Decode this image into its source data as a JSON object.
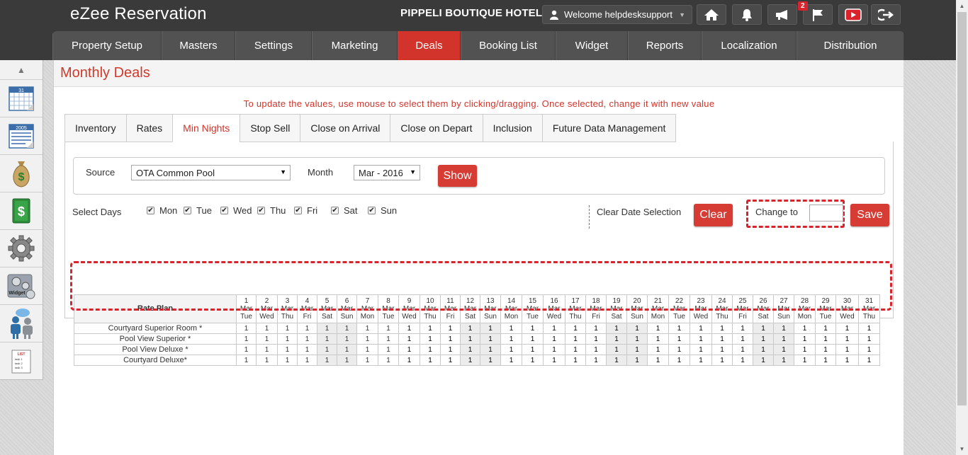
{
  "header": {
    "app_title": "eZee Reservation",
    "hotel_name": "PIPPELI BOUTIQUE HOTEL",
    "welcome": "Welcome helpdesksupport",
    "notification_count": "2",
    "icons": [
      "home-icon",
      "bell-icon",
      "megaphone-icon",
      "flag-icon",
      "youtube-icon",
      "logout-icon"
    ]
  },
  "nav": {
    "items": [
      {
        "label": "Property Setup",
        "active": false
      },
      {
        "label": "Masters",
        "active": false
      },
      {
        "label": "Settings",
        "active": false
      },
      {
        "label": "Marketing",
        "active": false
      },
      {
        "label": "Deals",
        "active": true
      },
      {
        "label": "Booking List",
        "active": false
      },
      {
        "label": "Widget",
        "active": false
      },
      {
        "label": "Reports",
        "active": false
      },
      {
        "label": "Localization",
        "active": false
      },
      {
        "label": "Distribution",
        "active": false
      }
    ]
  },
  "sidebar": {
    "calendar_small_label": "31",
    "calendar_year_label": "2005",
    "widget_label": "Widget",
    "list_label": "LIST",
    "list_tasks": [
      "task 1",
      "task 2",
      "task 3"
    ]
  },
  "page": {
    "title": "Monthly Deals",
    "instruction": "To update the values, use mouse to select them by clicking/dragging. Once selected, change it with new value"
  },
  "tabs": [
    {
      "label": "Inventory",
      "active": false
    },
    {
      "label": "Rates",
      "active": false
    },
    {
      "label": "Min Nights",
      "active": true
    },
    {
      "label": "Stop Sell",
      "active": false
    },
    {
      "label": "Close on Arrival",
      "active": false
    },
    {
      "label": "Close on Depart",
      "active": false
    },
    {
      "label": "Inclusion",
      "active": false
    },
    {
      "label": "Future Data Management",
      "active": false
    }
  ],
  "filter": {
    "source_label": "Source",
    "source_value": "OTA Common Pool",
    "month_label": "Month",
    "month_value": "Mar - 2016",
    "show_label": "Show"
  },
  "days": {
    "label": "Select Days",
    "items": [
      "Mon",
      "Tue",
      "Wed",
      "Thu",
      "Fri",
      "Sat",
      "Sun"
    ],
    "checked": [
      true,
      true,
      true,
      true,
      true,
      true,
      true
    ]
  },
  "actions": {
    "clear_date_label": "Clear Date Selection",
    "clear_label": "Clear",
    "change_to_label": "Change to",
    "change_to_value": "",
    "save_label": "Save"
  },
  "grid": {
    "rate_plan_header": "Rate Plan",
    "month_label": "Mar",
    "dates": [
      {
        "d": "1",
        "w": "Tue"
      },
      {
        "d": "2",
        "w": "Wed"
      },
      {
        "d": "3",
        "w": "Thu"
      },
      {
        "d": "4",
        "w": "Fri"
      },
      {
        "d": "5",
        "w": "Sat"
      },
      {
        "d": "6",
        "w": "Sun"
      },
      {
        "d": "7",
        "w": "Mon"
      },
      {
        "d": "8",
        "w": "Tue"
      },
      {
        "d": "9",
        "w": "Wed"
      },
      {
        "d": "10",
        "w": "Thu"
      },
      {
        "d": "11",
        "w": "Fri"
      },
      {
        "d": "12",
        "w": "Sat"
      },
      {
        "d": "13",
        "w": "Sun"
      },
      {
        "d": "14",
        "w": "Mon"
      },
      {
        "d": "15",
        "w": "Tue"
      },
      {
        "d": "16",
        "w": "Wed"
      },
      {
        "d": "17",
        "w": "Thu"
      },
      {
        "d": "18",
        "w": "Fri"
      },
      {
        "d": "19",
        "w": "Sat"
      },
      {
        "d": "20",
        "w": "Sun"
      },
      {
        "d": "21",
        "w": "Mon"
      },
      {
        "d": "22",
        "w": "Tue"
      },
      {
        "d": "23",
        "w": "Wed"
      },
      {
        "d": "24",
        "w": "Thu"
      },
      {
        "d": "25",
        "w": "Fri"
      },
      {
        "d": "26",
        "w": "Sat"
      },
      {
        "d": "27",
        "w": "Sun"
      },
      {
        "d": "28",
        "w": "Mon"
      },
      {
        "d": "29",
        "w": "Tue"
      },
      {
        "d": "30",
        "w": "Wed"
      },
      {
        "d": "31",
        "w": "Thu"
      }
    ],
    "rows": [
      {
        "name": "Courtyard Superior Room *",
        "values": [
          "1",
          "1",
          "1",
          "1",
          "1",
          "1",
          "1",
          "1",
          "1",
          "1",
          "1",
          "1",
          "1",
          "1",
          "1",
          "1",
          "1",
          "1",
          "1",
          "1",
          "1",
          "1",
          "1",
          "1",
          "1",
          "1",
          "1",
          "1",
          "1",
          "1",
          "1"
        ]
      },
      {
        "name": "Pool View Superior *",
        "values": [
          "1",
          "1",
          "1",
          "1",
          "1",
          "1",
          "1",
          "1",
          "1",
          "1",
          "1",
          "1",
          "1",
          "1",
          "1",
          "1",
          "1",
          "1",
          "1",
          "1",
          "1",
          "1",
          "1",
          "1",
          "1",
          "1",
          "1",
          "1",
          "1",
          "1",
          "1"
        ]
      },
      {
        "name": "Pool View Deluxe *",
        "values": [
          "1",
          "1",
          "1",
          "1",
          "1",
          "1",
          "1",
          "1",
          "1",
          "1",
          "1",
          "1",
          "1",
          "1",
          "1",
          "1",
          "1",
          "1",
          "1",
          "1",
          "1",
          "1",
          "1",
          "1",
          "1",
          "1",
          "1",
          "1",
          "1",
          "1",
          "1"
        ]
      },
      {
        "name": "Courtyard Deluxe*",
        "values": [
          "1",
          "1",
          "1",
          "1",
          "1",
          "1",
          "1",
          "1",
          "1",
          "1",
          "1",
          "1",
          "1",
          "1",
          "1",
          "1",
          "1",
          "1",
          "1",
          "1",
          "1",
          "1",
          "1",
          "1",
          "1",
          "1",
          "1",
          "1",
          "1",
          "1",
          "1"
        ]
      }
    ]
  }
}
